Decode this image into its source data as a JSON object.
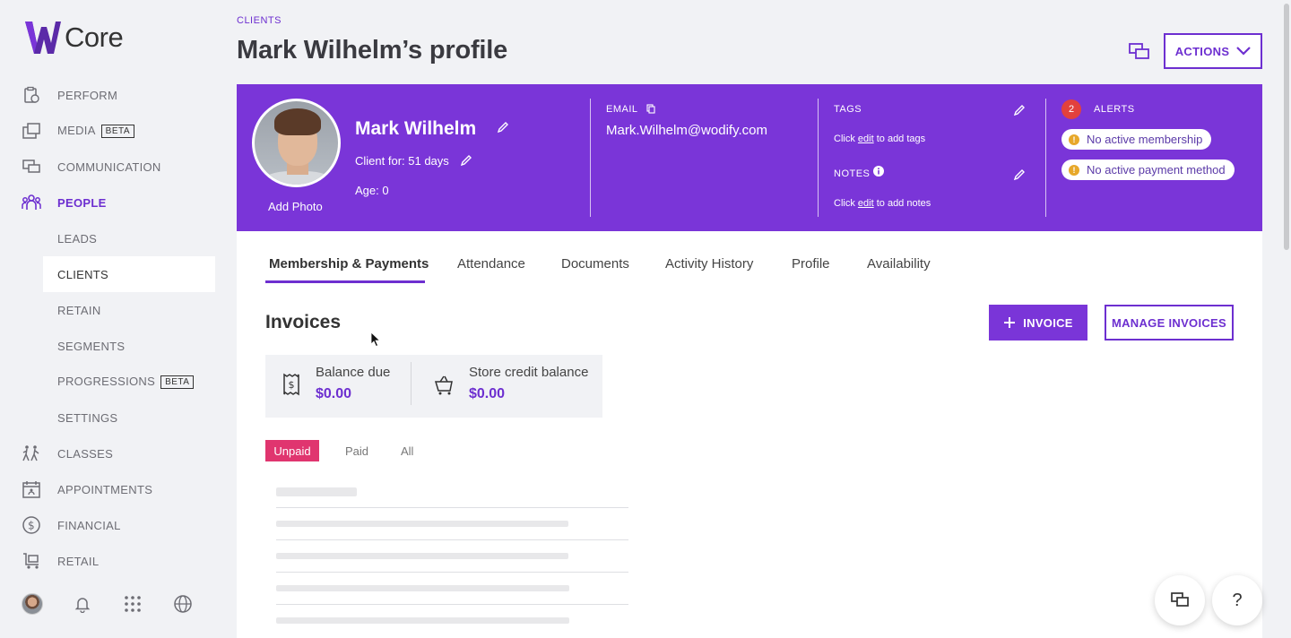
{
  "app": {
    "logo_text": "Core"
  },
  "sidebar": {
    "items": [
      {
        "label": "PERFORM",
        "icon": "clipboard-icon"
      },
      {
        "label": "MEDIA",
        "badge": "BETA",
        "icon": "media-icon"
      },
      {
        "label": "COMMUNICATION",
        "icon": "chat-icon"
      },
      {
        "label": "PEOPLE",
        "icon": "people-icon",
        "active": true
      },
      {
        "label": "LEADS"
      },
      {
        "label": "CLIENTS",
        "selected": true
      },
      {
        "label": "RETAIN"
      },
      {
        "label": "SEGMENTS"
      },
      {
        "label": "PROGRESSIONS",
        "badge": "BETA"
      },
      {
        "label": "SETTINGS"
      },
      {
        "label": "CLASSES",
        "icon": "classes-icon"
      },
      {
        "label": "APPOINTMENTS",
        "icon": "calendar-icon"
      },
      {
        "label": "FINANCIAL",
        "icon": "dollar-icon"
      },
      {
        "label": "RETAIL",
        "icon": "cart-icon"
      }
    ]
  },
  "header": {
    "breadcrumb": "CLIENTS",
    "title": "Mark Wilhelm’s profile",
    "actions_label": "ACTIONS"
  },
  "profile": {
    "add_photo": "Add Photo",
    "name": "Mark Wilhelm",
    "client_for": "Client for: 51 days",
    "age": "Age: 0",
    "email_label": "EMAIL",
    "email": "Mark.Wilhelm@wodify.com",
    "tags_label": "TAGS",
    "tags_click": "Click",
    "tags_edit": "edit",
    "tags_rest": "to add tags",
    "notes_label": "NOTES",
    "notes_click": "Click",
    "notes_edit": "edit",
    "notes_rest": "to add notes",
    "alerts_count": "2",
    "alerts_label": "ALERTS",
    "alert_1": "No active membership",
    "alert_2": "No active payment method",
    "header_color": "#7a35d8"
  },
  "tabs": [
    "Membership & Payments",
    "Attendance",
    "Documents",
    "Activity History",
    "Profile",
    "Availability"
  ],
  "invoices": {
    "title": "Invoices",
    "invoice_button": "INVOICE",
    "manage_button": "MANAGE INVOICES",
    "balance_due_label": "Balance due",
    "balance_due_value": "$0.00",
    "store_credit_label": "Store credit balance",
    "store_credit_value": "$0.00",
    "filters": {
      "unpaid": "Unpaid",
      "paid": "Paid",
      "all": "All"
    }
  },
  "floating": {
    "help": "?"
  },
  "colors": {
    "accent": "#6d2fd0",
    "alert_red": "#e2413d",
    "unpaid_pink": "#e0356f",
    "warning": "#e7a82a"
  }
}
